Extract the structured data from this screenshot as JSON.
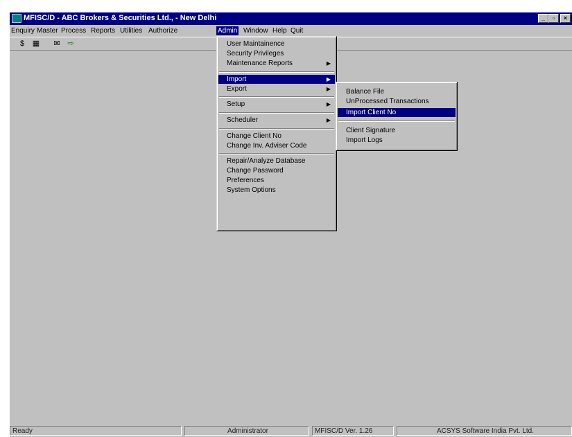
{
  "window": {
    "title": "MFISC/D - ABC Brokers & Securities Ltd., - New Delhi",
    "controls": [
      "_",
      "▫",
      "×"
    ]
  },
  "menubar": {
    "items": [
      "Enquiry",
      "Master",
      "Process",
      "Reports",
      "Utilities",
      "Authorize",
      "Admin",
      "Window",
      "Help",
      "Quit"
    ],
    "active": "Admin"
  },
  "toolbar": {
    "buttons": [
      {
        "icon": "dollar-icon",
        "glyph": "$"
      },
      {
        "icon": "calculator-icon",
        "glyph": "▦"
      },
      {
        "icon": "mail-icon",
        "glyph": "✉"
      },
      {
        "icon": "exit-door-icon",
        "glyph": "⇨"
      }
    ]
  },
  "admin_menu": {
    "items": [
      "User Maintainence",
      "Security Privileges",
      "Maintenance Reports",
      "Import",
      "Export",
      "Setup",
      "Scheduler",
      "Change Client No",
      "Change Inv. Adviser Code",
      "Repair/Analyze Database",
      "Change Password",
      "Preferences",
      "System Options"
    ],
    "active": "Import"
  },
  "import_menu": {
    "items": [
      "Balance File",
      "UnProcessed Transactions",
      "Import Client No",
      "Client Signature",
      "Import Logs"
    ],
    "active": "Import Client No"
  },
  "statusbar": {
    "status": "Ready",
    "user": "Administrator",
    "version": "MFISC/D Ver. 1.26",
    "company": "ACSYS Software India Pvt. Ltd."
  },
  "colors": {
    "titlebar": "#000080",
    "face": "#c0c0c0",
    "highlight": "#000080"
  }
}
